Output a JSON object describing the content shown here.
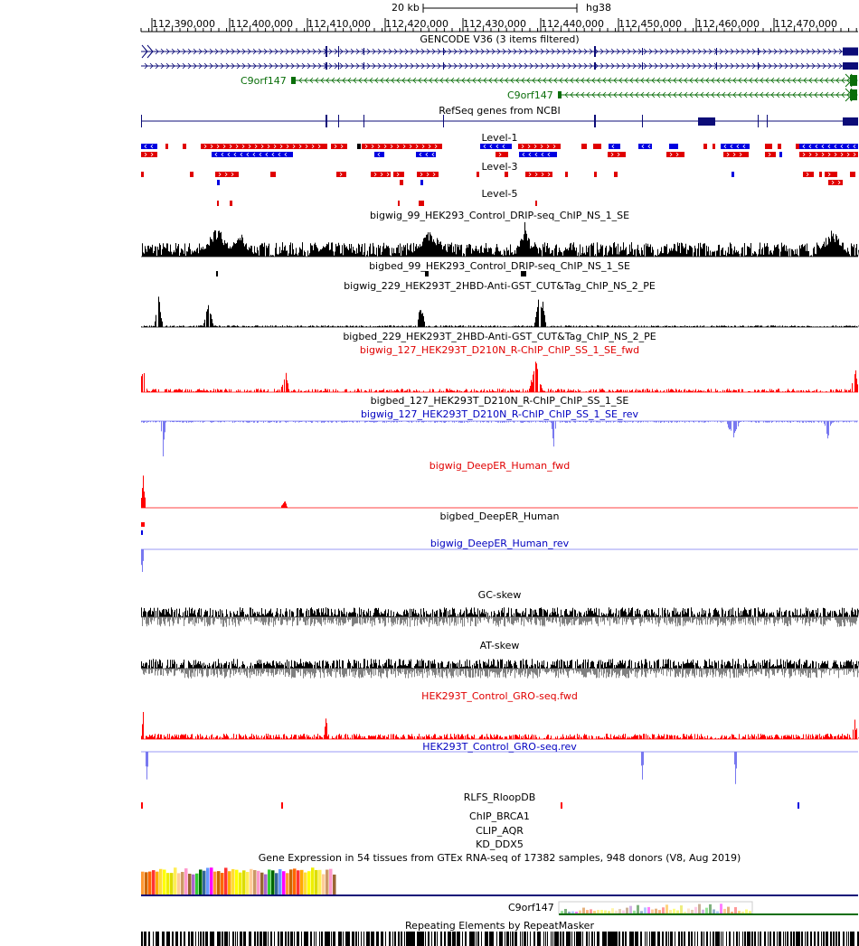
{
  "ruler": {
    "scale_label": "20 kb",
    "assembly": "hg38",
    "positions": [
      "112,390,000",
      "112,400,000",
      "112,410,000",
      "112,420,000",
      "112,430,000",
      "112,440,000",
      "112,450,000",
      "112,460,000",
      "112,470,000"
    ]
  },
  "tracks": {
    "gencode": "GENCODE V36 (3 items filtered)",
    "gene_1": "C9orf147",
    "gene_2": "C9orf147",
    "refseq": "RefSeq genes from NCBI",
    "level1": "Level-1",
    "level3": "Level-3",
    "level5": "Level-5",
    "bigwig99": "bigwig_99_HEK293_Control_DRIP-seq_ChIP_NS_1_SE",
    "bigbed99": "bigbed_99_HEK293_Control_DRIP-seq_ChIP_NS_1_SE",
    "bigwig229": "bigwig_229_HEK293T_2HBD-Anti-GST_CUT&Tag_ChIP_NS_2_PE",
    "bigbed229": "bigbed_229_HEK293T_2HBD-Anti-GST_CUT&Tag_ChIP_NS_2_PE",
    "bigwig127fwd": "bigwig_127_HEK293T_D210N_R-ChIP_ChIP_SS_1_SE_fwd",
    "bigbed127": "bigbed_127_HEK293T_D210N_R-ChIP_ChIP_SS_1_SE",
    "bigwig127rev": "bigwig_127_HEK293T_D210N_R-ChIP_ChIP_SS_1_SE_rev",
    "deeper_fwd": "bigwig_DeepER_Human_fwd",
    "deeper_bed": "bigbed_DeepER_Human",
    "deeper_rev": "bigwig_DeepER_Human_rev",
    "gcskew": "GC-skew",
    "atskew": "AT-skew",
    "gro_fwd": "HEK293T_Control_GRO-seq.fwd",
    "gro_rev": "HEK293T_Control_GRO-seq.rev",
    "rlfs": "RLFS_RloopDB",
    "chip_brca1": "ChIP_BRCA1",
    "clip_aqr": "CLIP_AQR",
    "kd_ddx5": "KD_DDX5",
    "gtex": "Gene Expression in 54 tissues from GTEx RNA-seq of 17382 samples, 948 donors (V8, Aug 2019)",
    "gtex_gene": "C9orf147",
    "repeatmasker": "Repeating Elements by RepeatMasker"
  },
  "colors": {
    "gene_blue": "#0c0c78",
    "gene_green": "#0a6e0a",
    "level_red": "#e00000",
    "level_blue": "#0000e0",
    "fwd_red": "#ff0000",
    "rev_blue": "#7878f0",
    "label_red": "#e00000",
    "label_blue": "#0000c0"
  }
}
